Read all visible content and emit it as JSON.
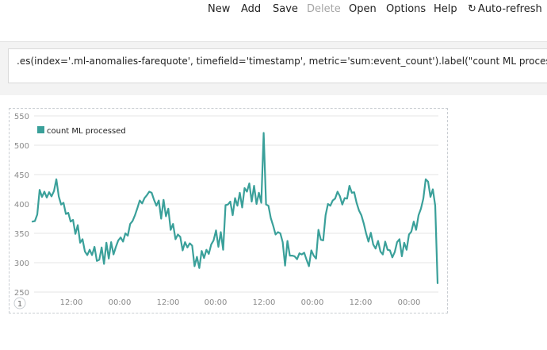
{
  "menu": {
    "new": "New",
    "add": "Add",
    "save": "Save",
    "delete": "Delete",
    "open": "Open",
    "options": "Options",
    "help": "Help",
    "auto_refresh": "Auto-refresh"
  },
  "expression": ".es(index='.ml-anomalies-farequote', timefield='timestamp', metric='sum:event_count').label(\"count ML processed\")",
  "chart_badge": "1",
  "colors": {
    "series": "#3aa09a",
    "grid": "#e6e6e6",
    "axis_text": "#8a8a8a"
  },
  "chart_data": {
    "type": "line",
    "title": "",
    "xlabel": "",
    "ylabel": "",
    "ylim": [
      250,
      550
    ],
    "yticks": [
      250,
      300,
      350,
      400,
      450,
      500,
      550
    ],
    "xtick_labels": [
      "12:00",
      "00:00",
      "12:00",
      "00:00",
      "12:00",
      "00:00",
      "12:00",
      "00:00"
    ],
    "grid": true,
    "legend_position": "top-left",
    "series": [
      {
        "name": "count ML processed",
        "values": [
          370,
          371,
          382,
          424,
          412,
          421,
          411,
          420,
          413,
          422,
          442,
          413,
          399,
          402,
          383,
          385,
          370,
          373,
          349,
          364,
          334,
          340,
          319,
          313,
          322,
          313,
          327,
          303,
          305,
          326,
          298,
          334,
          307,
          335,
          314,
          327,
          338,
          343,
          336,
          350,
          346,
          366,
          371,
          381,
          393,
          406,
          401,
          410,
          415,
          421,
          419,
          407,
          397,
          406,
          375,
          407,
          379,
          392,
          356,
          366,
          340,
          348,
          344,
          321,
          335,
          326,
          333,
          329,
          294,
          310,
          291,
          320,
          308,
          322,
          315,
          331,
          338,
          355,
          327,
          352,
          322,
          398,
          399,
          404,
          381,
          410,
          397,
          419,
          394,
          427,
          421,
          435,
          404,
          431,
          400,
          419,
          402,
          521,
          399,
          397,
          376,
          363,
          348,
          352,
          350,
          335,
          295,
          337,
          312,
          312,
          311,
          306,
          316,
          314,
          317,
          305,
          294,
          321,
          312,
          307,
          356,
          339,
          338,
          381,
          400,
          397,
          406,
          409,
          421,
          413,
          399,
          410,
          409,
          431,
          419,
          420,
          402,
          389,
          381,
          367,
          350,
          336,
          351,
          331,
          324,
          337,
          319,
          314,
          336,
          322,
          321,
          309,
          318,
          335,
          340,
          311,
          334,
          322,
          348,
          353,
          370,
          356,
          381,
          392,
          409,
          442,
          438,
          412,
          425,
          397,
          265
        ]
      }
    ]
  }
}
